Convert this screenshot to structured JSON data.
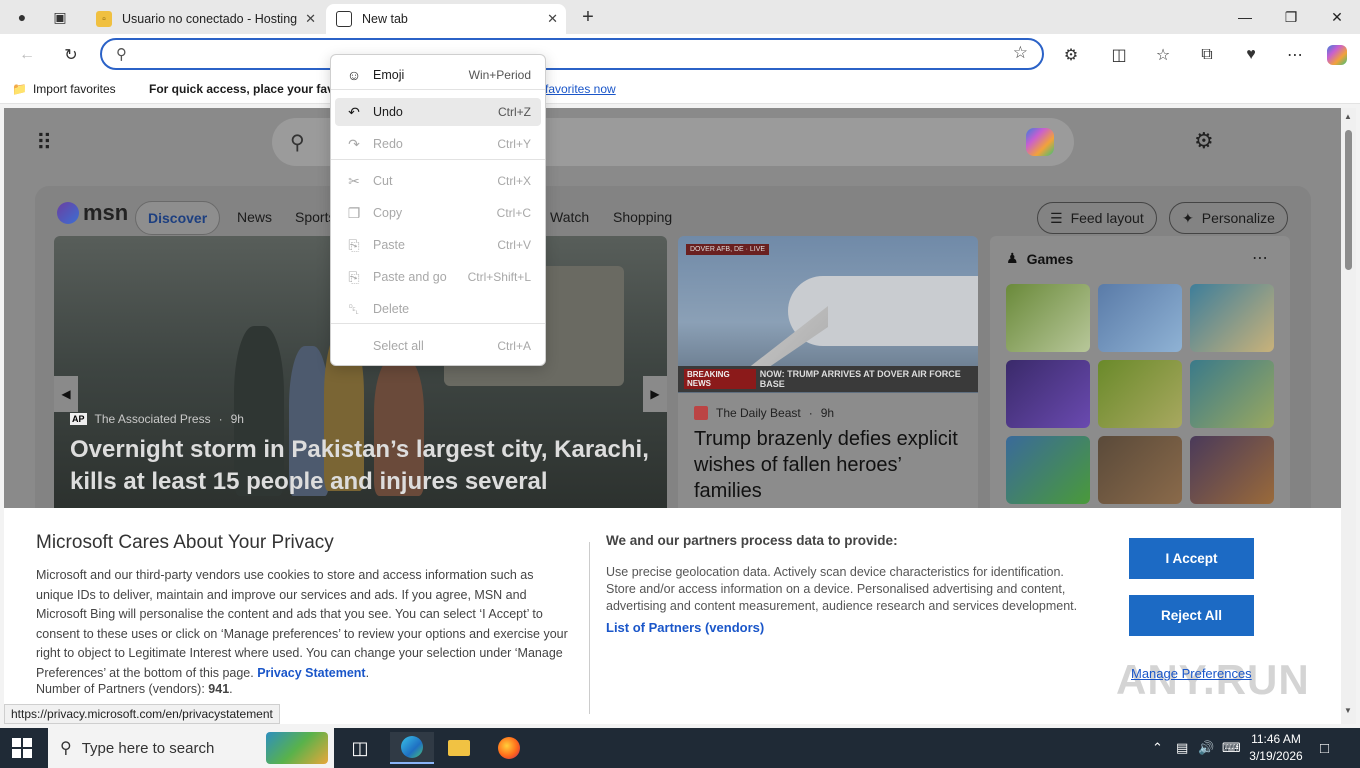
{
  "browser": {
    "tabs": [
      {
        "title": "Usuario no conectado - Hosting",
        "favicon": "hosting-favicon",
        "active": false
      },
      {
        "title": "New tab",
        "favicon": "newtab-icon",
        "active": true
      }
    ],
    "address_value": "",
    "favorites_bar": {
      "import_label": "Import favorites",
      "hint": "For quick access, place your favor",
      "manage_link": "favorites now"
    }
  },
  "context_menu": {
    "items": [
      {
        "icon": "emoji-icon",
        "label": "Emoji",
        "shortcut": "Win+Period",
        "enabled": true
      },
      {
        "icon": "undo-icon",
        "label": "Undo",
        "shortcut": "Ctrl+Z",
        "enabled": true,
        "hover": true
      },
      {
        "icon": "redo-icon",
        "label": "Redo",
        "shortcut": "Ctrl+Y",
        "enabled": false
      },
      {
        "icon": "cut-icon",
        "label": "Cut",
        "shortcut": "Ctrl+X",
        "enabled": false
      },
      {
        "icon": "copy-icon",
        "label": "Copy",
        "shortcut": "Ctrl+C",
        "enabled": false
      },
      {
        "icon": "paste-icon",
        "label": "Paste",
        "shortcut": "Ctrl+V",
        "enabled": false
      },
      {
        "icon": "paste-go-icon",
        "label": "Paste and go",
        "shortcut": "Ctrl+Shift+L",
        "enabled": false
      },
      {
        "icon": "delete-icon",
        "label": "Delete",
        "shortcut": "",
        "enabled": false
      },
      {
        "icon": "",
        "label": "Select all",
        "shortcut": "Ctrl+A",
        "enabled": false
      }
    ]
  },
  "msn": {
    "logo_text": "msn",
    "nav": [
      "Discover",
      "News",
      "Sports",
      "Watch",
      "Shopping"
    ],
    "feed_layout_label": "Feed layout",
    "personalize_label": "Personalize",
    "hero": {
      "source": "The Associated Press",
      "age": "9h",
      "headline": "Overnight storm in Pakistan’s largest city, Karachi, kills at least 15 people and injures several"
    },
    "card2": {
      "chyron": "DOVER AFB, DE · LIVE",
      "breaking": "BREAKING NEWS",
      "ticker": "NOW: TRUMP ARRIVES AT DOVER AIR FORCE BASE",
      "source": "The Daily Beast",
      "age": "9h",
      "headline": "Trump brazenly defies explicit wishes of fallen heroes’ families"
    },
    "games": {
      "title": "Games",
      "tiles": [
        {
          "name": "mahjong",
          "color": "#6a8a3a",
          "color2": "#b8c79a"
        },
        {
          "name": "runner",
          "color": "#5a7ba8",
          "color2": "#8fb2d4"
        },
        {
          "name": "coffee-puzzle",
          "color": "#3e7e9a",
          "color2": "#c9b27a"
        },
        {
          "name": "rocket",
          "color": "#3a2a6a",
          "color2": "#6a4ab0"
        },
        {
          "name": "soccer-run",
          "color": "#6a8a2a",
          "color2": "#a8a860"
        },
        {
          "name": "parking-jam",
          "color": "#3a7a8a",
          "color2": "#9aa860"
        },
        {
          "name": "shark-runner",
          "color": "#3a6a9a",
          "color2": "#4a9a3a"
        },
        {
          "name": "block-face",
          "color": "#5a4a3a",
          "color2": "#8a6a4a"
        },
        {
          "name": "basketball-stars",
          "color": "#4a3a5a",
          "color2": "#9a6a3a"
        }
      ]
    }
  },
  "consent": {
    "title": "Microsoft Cares About Your Privacy",
    "body": "Microsoft and our third-party vendors use cookies to store and access information such as unique IDs to deliver, maintain and improve our services and ads. If you agree, MSN and Microsoft Bing will personalise the content and ads that you see. You can select ‘I Accept’ to consent to these uses or click on ‘Manage preferences’ to review your options and exercise your right to object to Legitimate Interest where used.  You can change your selection under ‘Manage Preferences’ at the bottom of this page. ",
    "privacy_link": "Privacy Statement",
    "partners_label": "Number of Partners (vendors): ",
    "partners_count": "941",
    "right_title": "We and our partners process data to provide:",
    "right_body": "Use precise geolocation data. Actively scan device characteristics for identification. Store and/or access information on a device. Personalised advertising and content, advertising and content measurement, audience research and services development.",
    "partners_link": "List of Partners (vendors)",
    "accept": "I Accept",
    "reject": "Reject All",
    "manage": "Manage Preferences",
    "watermark": "ANY.RUN"
  },
  "status_url": "https://privacy.microsoft.com/en/privacystatement",
  "taskbar": {
    "search_placeholder": "Type here to search",
    "time": "11:46 AM",
    "date": "3/19/2026"
  },
  "colors": {
    "accent": "#2b62c7",
    "button": "#1c6ac4",
    "link": "#1a56c9",
    "taskbar": "#1f2a36"
  }
}
